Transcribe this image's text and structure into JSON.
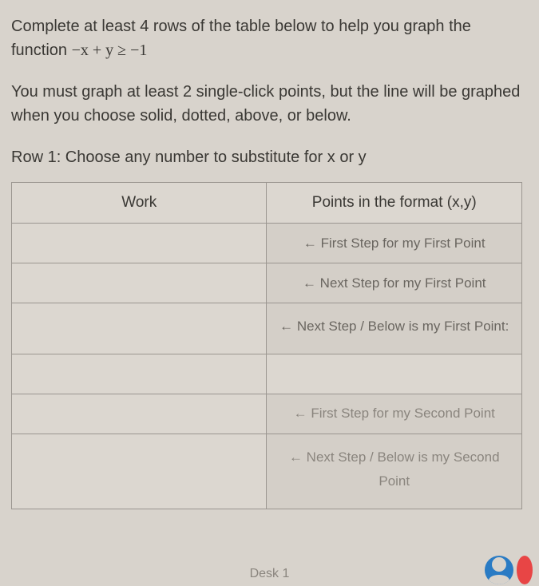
{
  "instructions": {
    "para1_part1": "Complete at least 4 rows of the table below to help you graph the function ",
    "para1_math": "−x + y ≥ −1",
    "para2": "You must graph at least 2 single-click points, but the line will be graphed when you choose solid, dotted, above, or below.",
    "row1_label": "Row 1: Choose any number to substitute for x or y"
  },
  "table": {
    "headers": {
      "work": "Work",
      "points": "Points in the format (x,y)"
    },
    "rows": [
      {
        "work": "",
        "points": "← First Step for my First Point"
      },
      {
        "work": "",
        "points": "← Next Step for my First Point"
      },
      {
        "work": "",
        "points": "← Next Step / Below is my First Point:"
      },
      {
        "work": "",
        "points": ""
      },
      {
        "work": "",
        "points": "← First Step for my Second Point"
      },
      {
        "work": "",
        "points": "← Next Step / Below is my Second Point"
      }
    ]
  },
  "footer": {
    "label": "Desk 1"
  }
}
